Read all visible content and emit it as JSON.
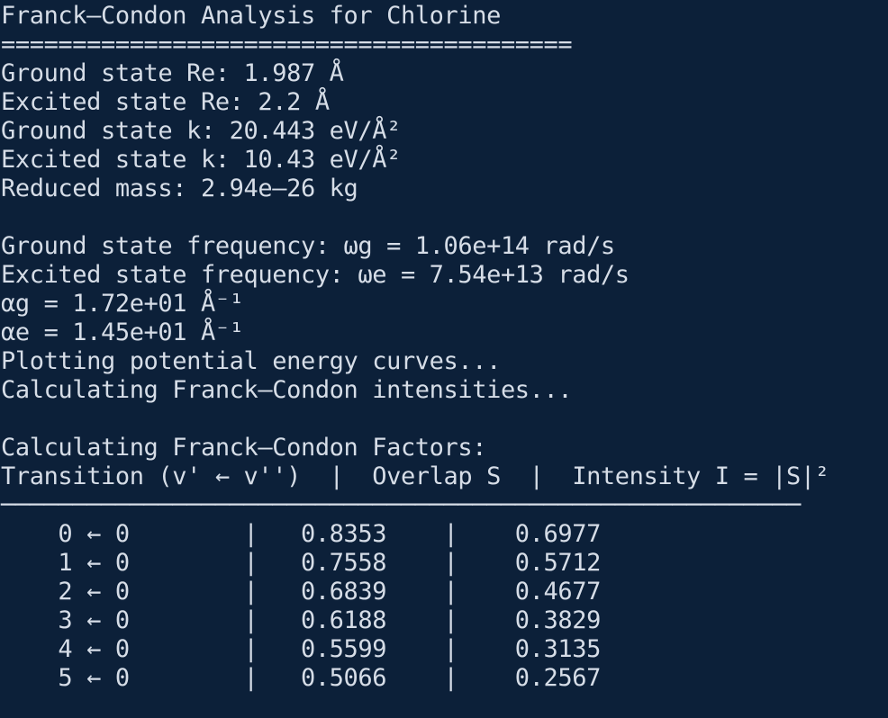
{
  "terminal": {
    "title": "Franck–Condon Analysis for Chlorine",
    "separator": "========================================",
    "params": [
      "Ground state Re: 1.987 Å",
      "Excited state Re: 2.2 Å",
      "Ground state k: 20.443 eV/Å²",
      "Excited state k: 10.43 eV/Å²",
      "Reduced mass: 2.94e–26 kg"
    ],
    "derived": [
      "Ground state frequency: ωg = 1.06e+14 rad/s",
      "Excited state frequency: ωe = 7.54e+13 rad/s",
      "αg = 1.72e+01 Å⁻¹",
      "αe = 1.45e+01 Å⁻¹",
      "Plotting potential energy curves...",
      "Calculating Franck–Condon intensities..."
    ],
    "factors_heading": "Calculating Franck–Condon Factors:",
    "table_header": "Transition (v' ← v'')  |  Overlap S  |  Intensity I = |S|²",
    "table_rule": "────────────────────────────────────────────────────────",
    "rows": [
      "    0 ← 0        |   0.8353    |    0.6977",
      "    1 ← 0        |   0.7558    |    0.5712",
      "    2 ← 0        |   0.6839    |    0.4677",
      "    3 ← 0        |   0.6188    |    0.3829",
      "    4 ← 0        |   0.5599    |    0.3135",
      "    5 ← 0        |   0.5066    |    0.2567"
    ]
  }
}
